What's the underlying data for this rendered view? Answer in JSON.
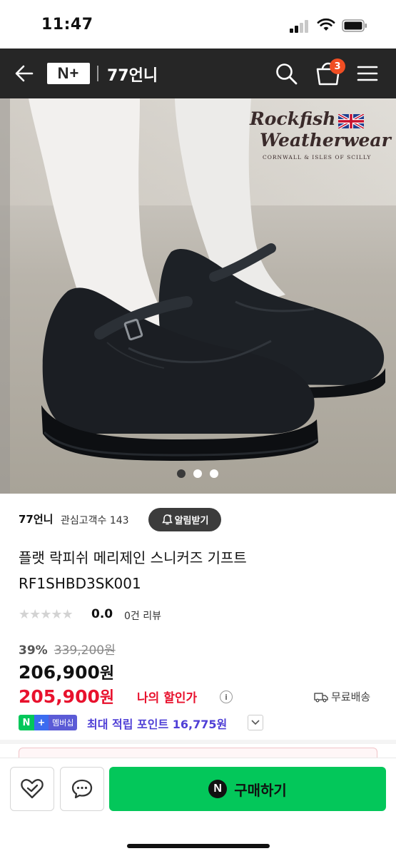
{
  "status_bar": {
    "time": "11:47"
  },
  "header": {
    "logo_text": "N+",
    "store_name": "77언니",
    "cart_count": "3"
  },
  "hero": {
    "brand_line1": "Rockfish",
    "brand_line2": "Weatherwear",
    "brand_sub": "CORNWALL & ISLES OF SCILLY",
    "slide_count": 3,
    "active_slide": 1
  },
  "store": {
    "name": "77언니",
    "followers": "관심고객수 143",
    "notify_label": "알림받기"
  },
  "product": {
    "title_line1": "플랫 락피쉬 메리제인 스니커즈 기프트",
    "title_line2": "RF1SHBD3SK001",
    "rating_stars": "★★★★★",
    "rating": "0.0",
    "review_count": "0건 리뷰",
    "discount_rate": "39%",
    "original_price": "339,200원",
    "sale_price": "206,900",
    "sale_unit": "원",
    "my_price": "205,900",
    "my_price_unit": "원",
    "my_price_label": "나의 할인가",
    "free_shipping": "무료배송"
  },
  "membership": {
    "n": "N",
    "plus": "+",
    "member_label": "멤버십",
    "points_text": "최대 적립 포인트 16,775원"
  },
  "bottom_bar": {
    "buy_label": "구매하기",
    "buy_icon_letter": "N"
  },
  "colors": {
    "header_bg": "#262626",
    "accent_red": "#e8112d",
    "naver_green": "#03c75a",
    "membership_purple": "#4f3fd6",
    "badge_orange": "#f04e23"
  }
}
